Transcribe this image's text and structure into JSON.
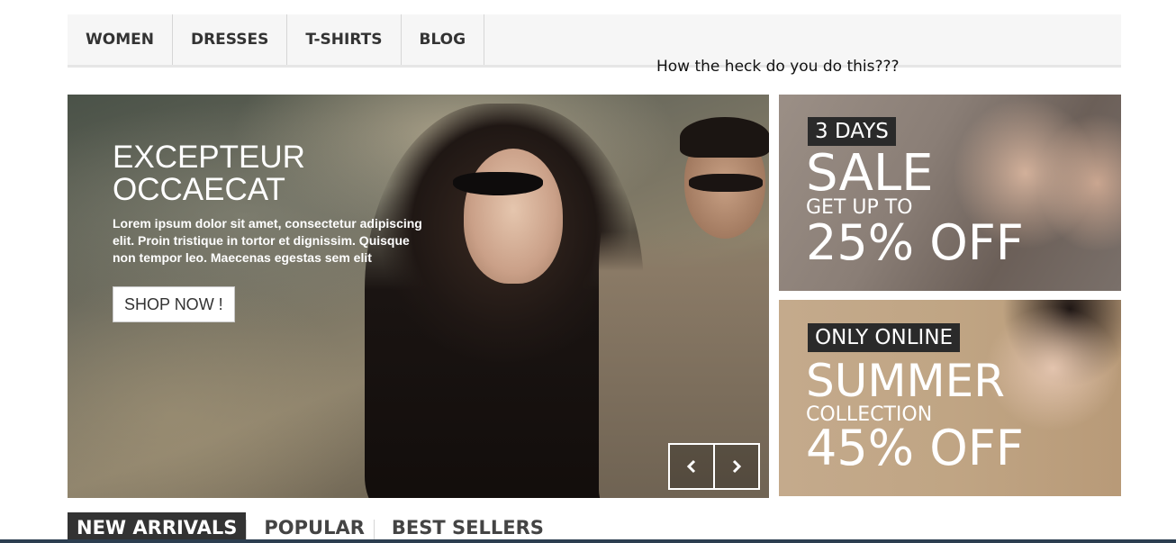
{
  "nav": {
    "items": [
      {
        "label": "WOMEN"
      },
      {
        "label": "DRESSES"
      },
      {
        "label": "T-SHIRTS"
      },
      {
        "label": "BLOG"
      }
    ]
  },
  "overlay_comment": "How the heck do you do this???",
  "slider": {
    "title": "EXCEPTEUR OCCAECAT",
    "text": "Lorem ipsum dolor sit amet, consectetur adipiscing elit. Proin tristique in tortor et dignissim. Quisque non tempor leo. Maecenas egestas sem elit",
    "button": "SHOP NOW !",
    "prev_icon": "chevron-left-icon",
    "next_icon": "chevron-right-icon"
  },
  "banners": [
    {
      "badge": "3 DAYS",
      "line1": "SALE",
      "line2": "GET UP TO",
      "line3": "25% OFF"
    },
    {
      "badge": "ONLY ONLINE",
      "line1": "SUMMER",
      "line2": "COLLECTION",
      "line3": "45% OFF"
    }
  ],
  "tabs": [
    {
      "label": "NEW ARRIVALS",
      "active": true
    },
    {
      "label": "POPULAR"
    },
    {
      "label": "BEST SELLERS"
    }
  ],
  "colors": {
    "nav_bg": "#f6f6f6",
    "badge_bg": "#2a2a2a",
    "active_tab": "#333333"
  }
}
